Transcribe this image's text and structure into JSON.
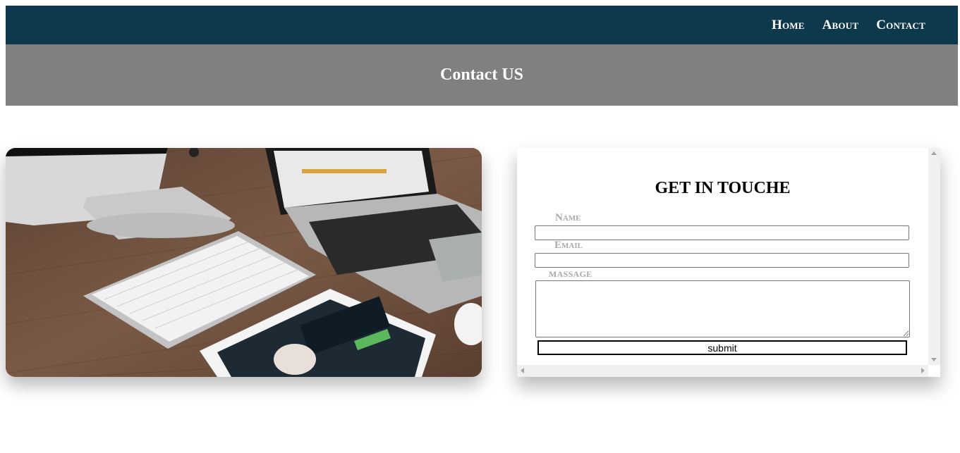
{
  "nav": {
    "links": [
      {
        "label": "Home"
      },
      {
        "label": "About"
      },
      {
        "label": "Contact"
      }
    ]
  },
  "banner": {
    "title": "Contact US"
  },
  "photo": {
    "icon": "workspace-photo",
    "subject": "desktop-laptop-keyboard-tablet"
  },
  "form": {
    "title": "GET IN TOUCHE",
    "name_label": "Name",
    "email_label": "Email",
    "message_label": "MASSAGE",
    "name_value": "",
    "email_value": "",
    "message_value": "",
    "submit_label": "submit"
  },
  "colors": {
    "nav_bg": "#0e384b",
    "banner_bg": "#808080",
    "label_color": "#a9a9a9"
  }
}
